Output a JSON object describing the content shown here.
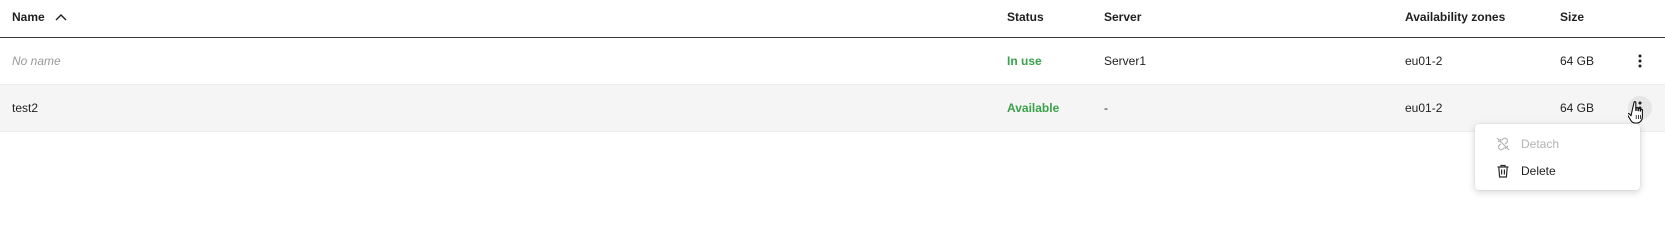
{
  "table": {
    "columns": {
      "name": "Name",
      "status": "Status",
      "server": "Server",
      "availability_zones": "Availability zones",
      "size": "Size"
    },
    "sort": {
      "column": "name",
      "direction": "ascending",
      "icon": "chevron-up-icon"
    },
    "rows": [
      {
        "name": "No name",
        "name_is_placeholder": true,
        "status": "In use",
        "server": "Server1",
        "availability_zone": "eu01-2",
        "size": "64 GB"
      },
      {
        "name": "test2",
        "name_is_placeholder": false,
        "status": "Available",
        "server": "-",
        "availability_zone": "eu01-2",
        "size": "64 GB"
      }
    ]
  },
  "context_menu": {
    "items": [
      {
        "label": "Detach",
        "icon": "unlink-icon",
        "disabled": true
      },
      {
        "label": "Delete",
        "icon": "trash-icon",
        "disabled": false
      }
    ]
  },
  "colors": {
    "status_green": "#3aa24a",
    "header_divider": "#3a3a3a",
    "hover_row": "#f5f5f5",
    "disabled_text": "#b4b4b4"
  }
}
